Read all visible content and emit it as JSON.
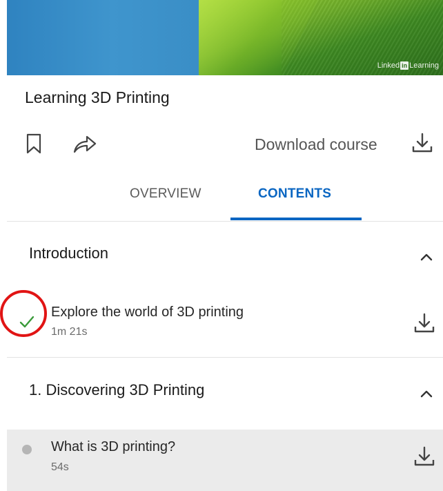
{
  "banner": {
    "logo_text_1": "Linked",
    "logo_text_2": "in",
    "logo_text_3": "Learning"
  },
  "course": {
    "title": "Learning 3D Printing"
  },
  "actions": {
    "download_course_label": "Download course"
  },
  "tabs": [
    {
      "label": "OVERVIEW",
      "active": false
    },
    {
      "label": "CONTENTS",
      "active": true
    }
  ],
  "sections": [
    {
      "title": "Introduction",
      "lessons": [
        {
          "title": "Explore the world of 3D printing",
          "duration": "1m 21s",
          "status": "completed"
        }
      ]
    },
    {
      "title": "1. Discovering 3D Printing",
      "lessons": [
        {
          "title": "What is 3D printing?",
          "duration": "54s",
          "status": "not-started"
        }
      ]
    }
  ],
  "colors": {
    "accent": "#0a66c2",
    "check": "#3a9a3a",
    "annotation": "#e11414",
    "highlight_row": "#ebebeb"
  }
}
